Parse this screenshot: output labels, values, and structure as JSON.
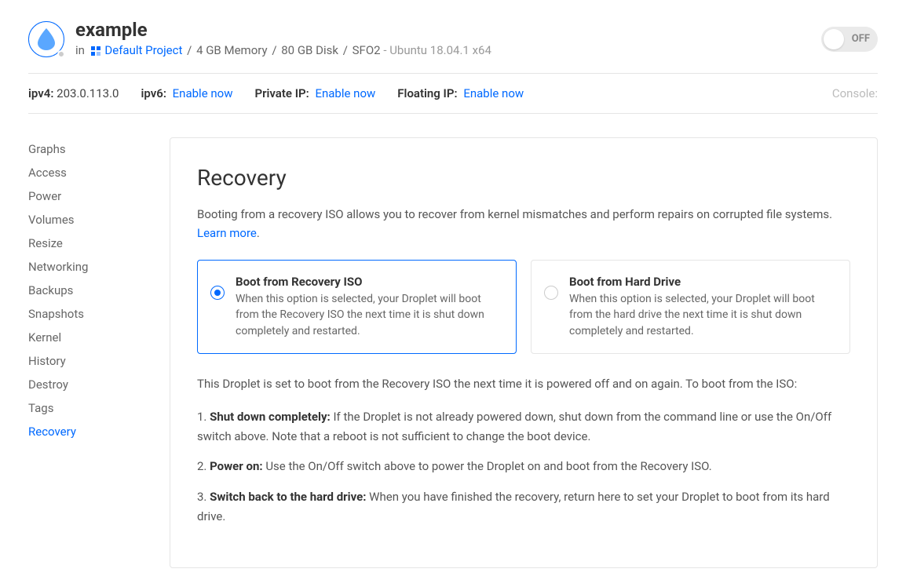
{
  "header": {
    "name": "example",
    "in_label": "in",
    "project_name": "Default Project",
    "specs_memory": "4 GB Memory",
    "specs_disk": "80 GB Disk",
    "specs_region": "SFO2",
    "os": "Ubuntu 18.04.1 x64",
    "toggle_label": "OFF"
  },
  "info": {
    "ipv4_label": "ipv4:",
    "ipv4_value": "203.0.113.0",
    "ipv6_label": "ipv6:",
    "ipv6_action": "Enable now",
    "private_ip_label": "Private IP:",
    "private_ip_action": "Enable now",
    "floating_ip_label": "Floating IP:",
    "floating_ip_action": "Enable now",
    "console_label": "Console:"
  },
  "sidebar": {
    "items": [
      "Graphs",
      "Access",
      "Power",
      "Volumes",
      "Resize",
      "Networking",
      "Backups",
      "Snapshots",
      "Kernel",
      "History",
      "Destroy",
      "Tags",
      "Recovery"
    ],
    "active_index": 12
  },
  "content": {
    "title": "Recovery",
    "description": "Booting from a recovery ISO allows you to recover from kernel mismatches and perform repairs on corrupted file systems. ",
    "learn_more": "Learn more",
    "period": ".",
    "options": [
      {
        "title": "Boot from Recovery ISO",
        "desc": "When this option is selected, your Droplet will boot from the Recovery ISO the next time it is shut down completely and restarted.",
        "selected": true
      },
      {
        "title": "Boot from Hard Drive",
        "desc": "When this option is selected, your Droplet will boot from the hard drive the next time it is shut down completely and restarted.",
        "selected": false
      }
    ],
    "status_text": "This Droplet is set to boot from the Recovery ISO the next time it is powered off and on again. To boot from the ISO:",
    "steps": [
      {
        "num": "1.",
        "strong": "Shut down completely:",
        "text": " If the Droplet is not already powered down, shut down from the command line or use the On/Off switch above. Note that a reboot is not sufficient to change the boot device."
      },
      {
        "num": "2.",
        "strong": "Power on:",
        "text": " Use the On/Off switch above to power the Droplet on and boot from the Recovery ISO."
      },
      {
        "num": "3.",
        "strong": "Switch back to the hard drive:",
        "text": " When you have finished the recovery, return here to set your Droplet to boot from its hard drive."
      }
    ]
  }
}
